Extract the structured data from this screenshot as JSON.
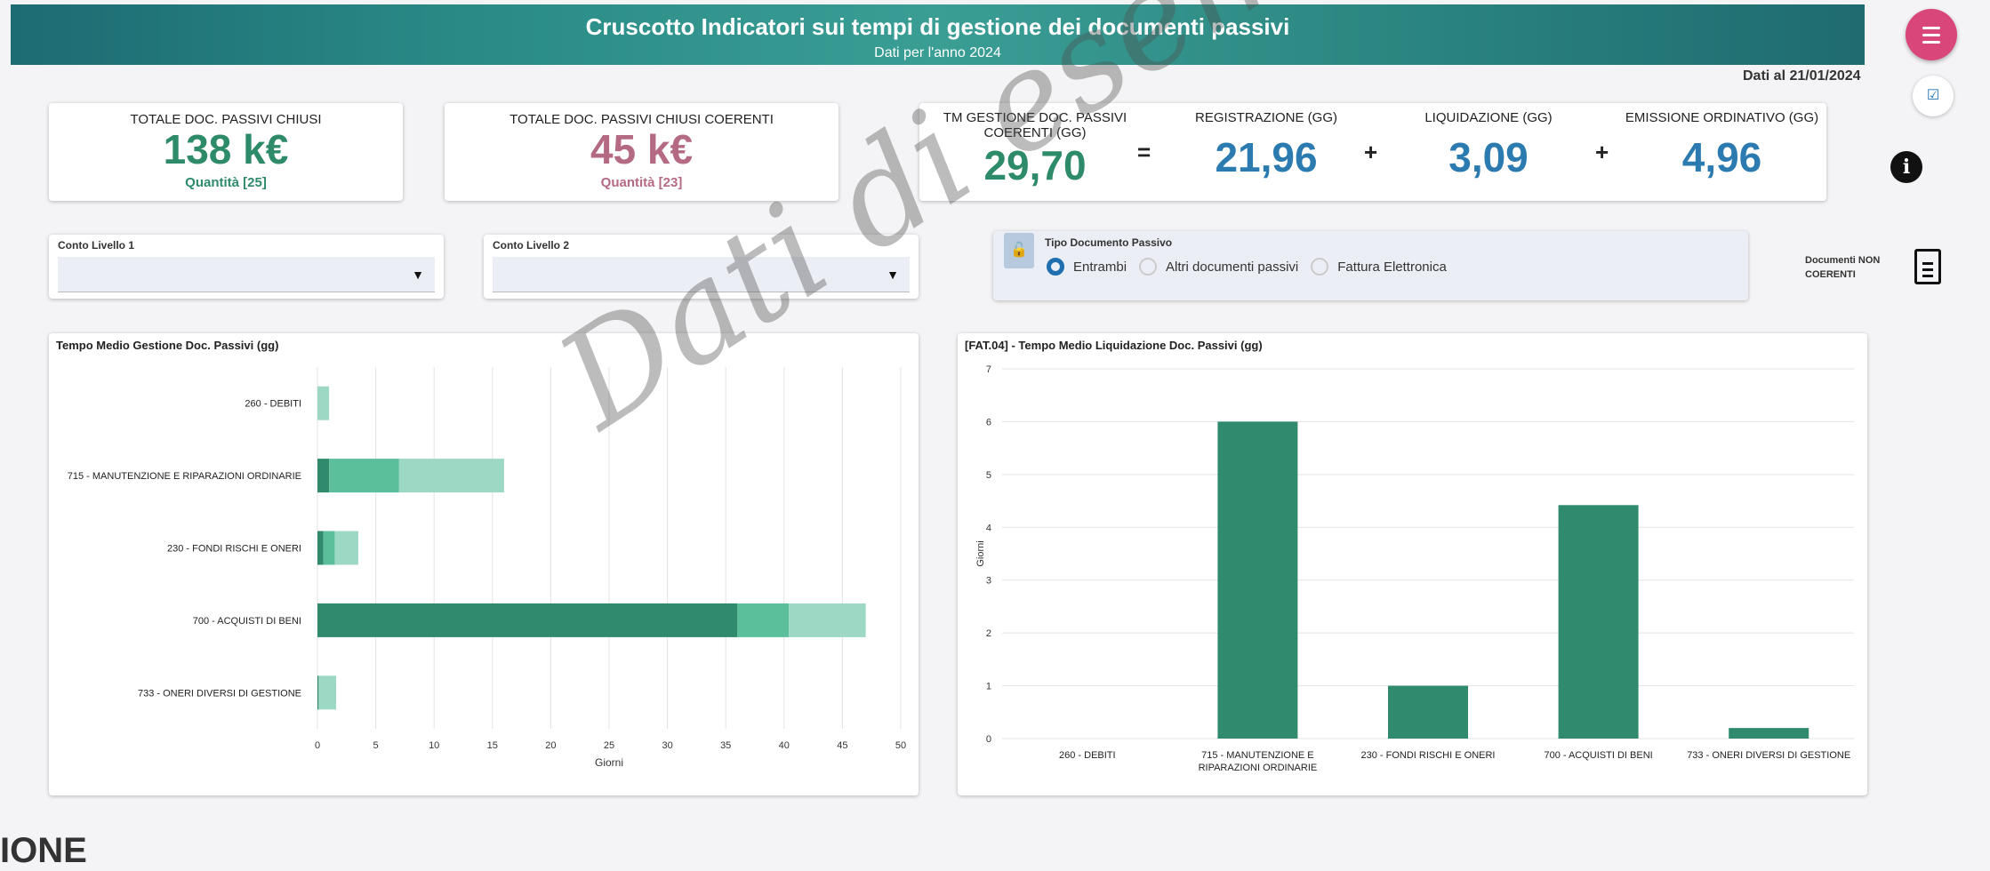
{
  "header": {
    "title": "Cruscotto Indicatori sui tempi di gestione dei documenti passivi",
    "subtitle": "Dati per l'anno 2024",
    "date_label": "Dati al 21/01/2024"
  },
  "kpi_cards": [
    {
      "title": "TOTALE DOC. PASSIVI CHIUSI",
      "value": "138 k€",
      "quantity": "Quantità [25]"
    },
    {
      "title": "TOTALE DOC. PASSIVI CHIUSI COERENTI",
      "value": "45 k€",
      "quantity": "Quantità [23]"
    }
  ],
  "tm_card": {
    "items": [
      {
        "label": "TM GESTIONE DOC. PASSIVI COERENTI (GG)",
        "value": "29,70"
      },
      {
        "label": "REGISTRAZIONE (GG)",
        "value": "21,96"
      },
      {
        "label": "LIQUIDAZIONE (GG)",
        "value": "3,09"
      },
      {
        "label": "EMISSIONE ORDINATIVO (GG)",
        "value": "4,96"
      }
    ],
    "operators": [
      "=",
      "+",
      "+"
    ]
  },
  "filters": {
    "conto1_label": "Conto Livello 1",
    "conto2_label": "Conto Livello 2",
    "tipo_label": "Tipo Documento Passivo",
    "options": [
      "Entrambi",
      "Altri documenti passivi",
      "Fattura Elettronica"
    ],
    "selected": "Entrambi"
  },
  "side": {
    "doc_non_coerenti": "Documenti NON COERENTI"
  },
  "colors": {
    "dark": "#2f8a6e",
    "mid": "#5cbf9b",
    "light": "#9dd8c4",
    "accent": "#d9467a"
  },
  "chart_data": [
    {
      "type": "bar",
      "orientation": "horizontal",
      "stacked": true,
      "title": "Tempo Medio Gestione Doc. Passivi (gg)",
      "xlabel": "Giorni",
      "categories": [
        "260 - DEBITI",
        "715 - MANUTENZIONE E RIPARAZIONI ORDINARIE",
        "230 - FONDI RISCHI E ONERI",
        "700 - ACQUISTI DI BENI",
        "733 - ONERI DIVERSI DI GESTIONE"
      ],
      "series": [
        {
          "values": [
            0,
            1,
            0.5,
            36,
            0.1
          ]
        },
        {
          "values": [
            0,
            6,
            1,
            4.4,
            0
          ]
        },
        {
          "values": [
            1,
            9,
            2,
            6.6,
            1.5
          ]
        }
      ],
      "xlim": [
        0,
        50
      ],
      "xticks": [
        0,
        5,
        10,
        15,
        20,
        25,
        30,
        35,
        40,
        45,
        50
      ]
    },
    {
      "type": "bar",
      "title": "[FAT.04] - Tempo Medio Liquidazione Doc. Passivi (gg)",
      "ylabel": "Giorni",
      "categories": [
        "260 - DEBITI",
        "715 - MANUTENZIONE E RIPARAZIONI ORDINARIE",
        "230 - FONDI RISCHI E ONERI",
        "700 - ACQUISTI DI BENI",
        "733 - ONERI DIVERSI DI GESTIONE"
      ],
      "values": [
        0,
        6,
        1,
        4.42,
        0.2
      ],
      "ylim": [
        0,
        7
      ],
      "yticks": [
        0,
        1,
        2,
        3,
        4,
        5,
        6,
        7
      ]
    }
  ],
  "watermark": "Dati di esempio",
  "bottom_fragment": "IONE"
}
